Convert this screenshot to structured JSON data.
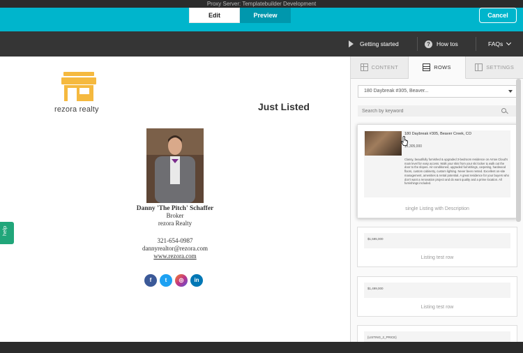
{
  "proxy_bar": {
    "text": "Proxy Server: Templatebuilder Development"
  },
  "header": {
    "edit_label": "Edit",
    "preview_label": "Preview",
    "cancel_label": "Cancel"
  },
  "nav": {
    "getting_started": "Getting started",
    "how_tos": "How tos",
    "faqs": "FAQs"
  },
  "canvas": {
    "logo_text": "rezora realty",
    "heading": "Just Listed",
    "agent": {
      "name": "Danny 'The Pitch' Schaffer",
      "title": "Broker",
      "company": "rezora Realty",
      "phone": "321-654-0987",
      "email": "dannyrealtor@rezora.com",
      "website": "www.rezora.com"
    },
    "socials": [
      {
        "name": "facebook",
        "glyph": "f",
        "color": "#3b5998"
      },
      {
        "name": "twitter",
        "glyph": "t",
        "color": "#1da1f2"
      },
      {
        "name": "instagram",
        "glyph": "◎",
        "color": "#c13584"
      },
      {
        "name": "linkedin",
        "glyph": "in",
        "color": "#0077b5"
      }
    ],
    "help_label": "help"
  },
  "panel": {
    "tabs": [
      {
        "label": "CONTENT",
        "icon": "grid-icon"
      },
      {
        "label": "ROWS",
        "icon": "rows-icon"
      },
      {
        "label": "SETTINGS",
        "icon": "settings-icon"
      }
    ],
    "select_value": "180 Daybreak #305, Beaver...",
    "search_placeholder": "Search by keyword",
    "cards": [
      {
        "title": "180 Daybreak #305, Beaver Creek, CO",
        "price": "$1,305,000",
        "description": "Classy, beautifully furnished & upgraded 3-bedroom residence on Arrow Cloud's main level for easy access. Walk your skis from your ski locker & walk out the door to the slopes. Air-conditioned, upgraded furnishings, carpeting, hardwood floors, custom cabinetry, custom lighting. Never been rented. Excellent on-site management, amenities & rental potential. A great residence for your buyers who don't want a renovation project and do want quality and a prime location. All furnishings included.",
        "label": "single Listing with Description"
      },
      {
        "price": "$1,595,000",
        "label": "Listing test row"
      },
      {
        "price": "$1,499,000",
        "label": "Listing test row"
      },
      {
        "price": "{LISTING_2_PRICE}"
      }
    ]
  },
  "colors": {
    "teal": "#00b5cc",
    "dark_nav": "#353535",
    "logo_orange": "#f5b93f",
    "help_green": "#21a67a"
  }
}
